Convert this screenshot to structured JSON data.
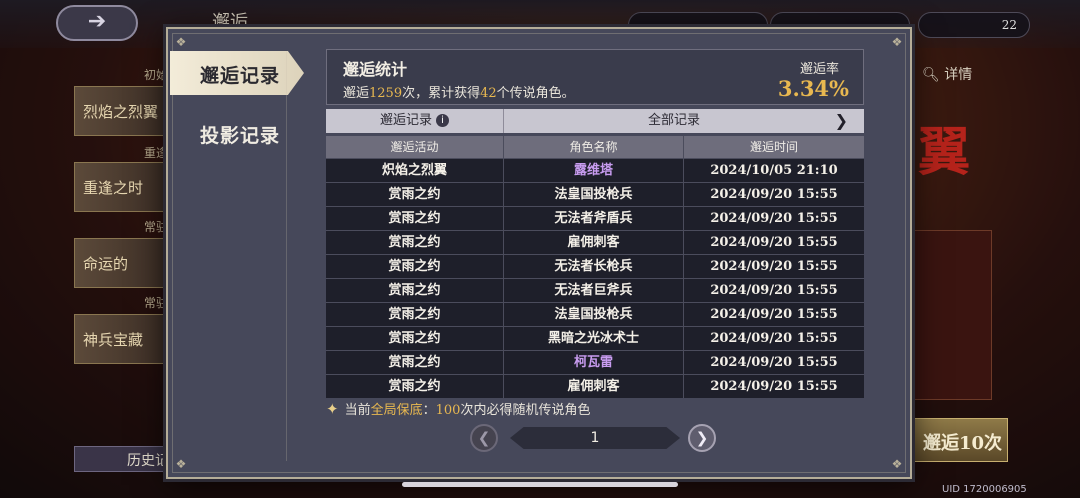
{
  "background": {
    "top_title": "邂逅",
    "currency_1": "",
    "currency_2": "",
    "currency_3": "22",
    "side_cards": [
      "烈焰之烈翼",
      "重逢之时",
      "命运的",
      "神兵宝藏"
    ],
    "side_labels": [
      "初始",
      "重逢",
      "常驻",
      "常驻"
    ],
    "history_label": "历史记",
    "detail_label": "详情",
    "art_text": "翼",
    "summon_label": "邂逅10次",
    "uid": "UID 1720006905"
  },
  "tabs": [
    {
      "label": "邂逅记录",
      "active": true
    },
    {
      "label": "投影记录",
      "active": false
    }
  ],
  "stats": {
    "title": "邂逅统计",
    "prefix": "邂逅",
    "count": "1259",
    "middle": "次，累计获得",
    "legend_count": "42",
    "suffix": "个传说角色。",
    "rate_label": "邂逅率",
    "rate_value": "3.34%"
  },
  "record_bar": {
    "left_label": "邂逅记录",
    "filter_label": "全部记录",
    "info_icon": "info-icon",
    "arrow_icon": "chevron-right-icon"
  },
  "table": {
    "headers": [
      "邂逅活动",
      "角色名称",
      "邂逅时间"
    ],
    "rows": [
      {
        "activity": "炽焰之烈翼",
        "character": "露维塔",
        "time": "2024/10/05 21:10",
        "legendary": true
      },
      {
        "activity": "赏雨之约",
        "character": "法皇国投枪兵",
        "time": "2024/09/20 15:55",
        "legendary": false
      },
      {
        "activity": "赏雨之约",
        "character": "无法者斧盾兵",
        "time": "2024/09/20 15:55",
        "legendary": false
      },
      {
        "activity": "赏雨之约",
        "character": "雇佣刺客",
        "time": "2024/09/20 15:55",
        "legendary": false
      },
      {
        "activity": "赏雨之约",
        "character": "无法者长枪兵",
        "time": "2024/09/20 15:55",
        "legendary": false
      },
      {
        "activity": "赏雨之约",
        "character": "无法者巨斧兵",
        "time": "2024/09/20 15:55",
        "legendary": false
      },
      {
        "activity": "赏雨之约",
        "character": "法皇国投枪兵",
        "time": "2024/09/20 15:55",
        "legendary": false
      },
      {
        "activity": "赏雨之约",
        "character": "黑暗之光冰术士",
        "time": "2024/09/20 15:55",
        "legendary": false
      },
      {
        "activity": "赏雨之约",
        "character": "柯瓦雷",
        "time": "2024/09/20 15:55",
        "legendary": true
      },
      {
        "activity": "赏雨之约",
        "character": "雇佣刺客",
        "time": "2024/09/20 15:55",
        "legendary": false
      }
    ]
  },
  "guarantee": {
    "icon": "sparkle-icon",
    "prefix": "当前",
    "highlight_1": "全局保底",
    "colon": "：",
    "highlight_2": "100",
    "suffix": "次内必得随机传说角色"
  },
  "pagination": {
    "page": "1",
    "prev_icon": "chevron-left-icon",
    "next_icon": "chevron-right-icon"
  },
  "colors": {
    "legendary": "#c89cf0",
    "accent_gold": "#e8b850"
  }
}
